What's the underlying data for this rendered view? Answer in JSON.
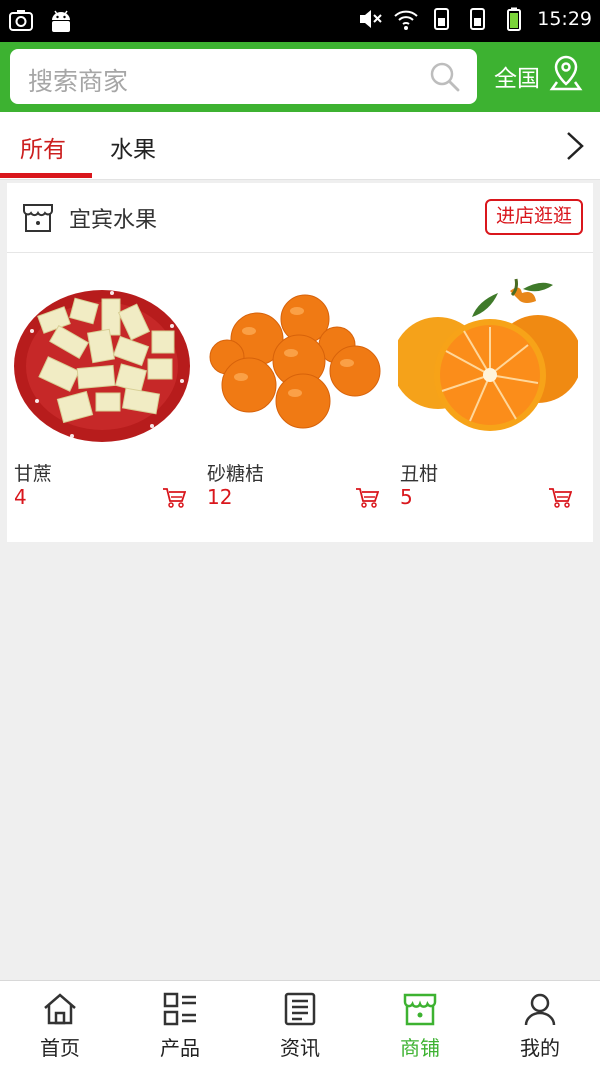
{
  "status_bar": {
    "time": "15:29"
  },
  "header": {
    "search_placeholder": "搜索商家",
    "region": "全国"
  },
  "tabs": [
    {
      "label": "所有",
      "active": true
    },
    {
      "label": "水果",
      "active": false
    }
  ],
  "shop": {
    "name": "宜宾水果",
    "visit_label": "进店逛逛",
    "products": [
      {
        "name": "甘蔗",
        "price": "4"
      },
      {
        "name": "砂糖桔",
        "price": "12"
      },
      {
        "name": "丑柑",
        "price": "5"
      }
    ]
  },
  "bottom_nav": [
    {
      "label": "首页",
      "icon": "home-icon"
    },
    {
      "label": "产品",
      "icon": "list-icon"
    },
    {
      "label": "资讯",
      "icon": "news-icon"
    },
    {
      "label": "商铺",
      "icon": "shop-icon",
      "active": true
    },
    {
      "label": "我的",
      "icon": "user-icon"
    }
  ],
  "colors": {
    "brand_green": "#3db231",
    "accent_red": "#d9161c",
    "background": "#efefef"
  }
}
